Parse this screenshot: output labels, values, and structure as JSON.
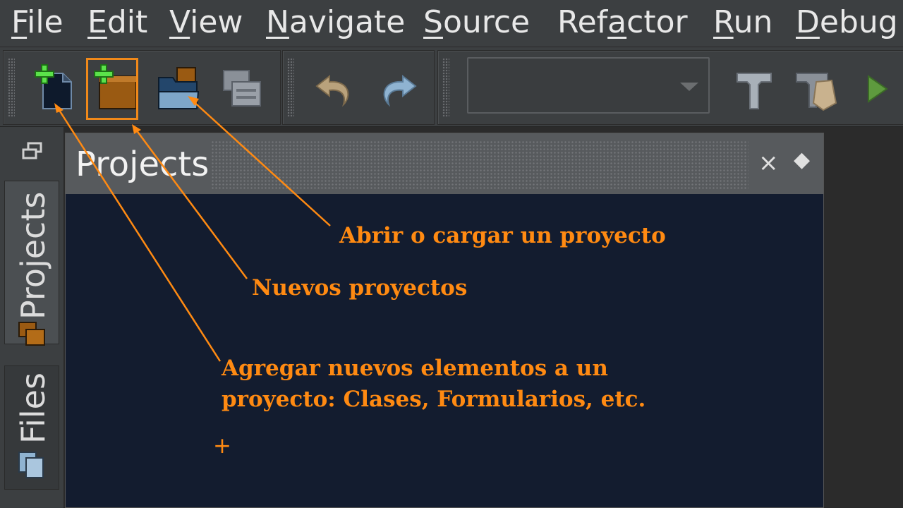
{
  "menu": {
    "items": [
      {
        "label": "File",
        "mnemonic": "F"
      },
      {
        "label": "Edit",
        "mnemonic": "E"
      },
      {
        "label": "View",
        "mnemonic": "V"
      },
      {
        "label": "Navigate",
        "mnemonic": "N"
      },
      {
        "label": "Source",
        "mnemonic": "S"
      },
      {
        "label": "Refactor",
        "mnemonic": "a"
      },
      {
        "label": "Run",
        "mnemonic": "R"
      },
      {
        "label": "Debug",
        "mnemonic": "D"
      }
    ]
  },
  "toolbar": {
    "buttons": [
      {
        "name": "new-file-button",
        "icon": "new-file-icon"
      },
      {
        "name": "new-project-button",
        "icon": "new-project-icon"
      },
      {
        "name": "open-project-button",
        "icon": "open-project-icon"
      },
      {
        "name": "close-project-button",
        "icon": "close-project-icon"
      },
      {
        "name": "undo-button",
        "icon": "undo-icon"
      },
      {
        "name": "redo-button",
        "icon": "redo-icon"
      },
      {
        "name": "build-button",
        "icon": "hammer-icon"
      },
      {
        "name": "clean-build-button",
        "icon": "clean-build-icon"
      },
      {
        "name": "run-button",
        "icon": "play-icon"
      }
    ],
    "config_combo": {
      "value": ""
    }
  },
  "side_tabs": {
    "projects": "Projects",
    "files": "Files"
  },
  "panel": {
    "title": "Projects",
    "close_glyph": "×",
    "menu_glyph": "◆"
  },
  "annotations": {
    "open_project": "Abrir o cargar un proyecto",
    "new_projects": "Nuevos proyectos",
    "add_elements_line1": "Agregar nuevos elementos a un",
    "add_elements_line2": "proyecto: Clases, Formularios, etc.",
    "crosshair": "+"
  },
  "colors": {
    "accent_orange": "#f0891a",
    "panel_bg": "#131c2f",
    "menu_bg": "#3c3f41"
  }
}
